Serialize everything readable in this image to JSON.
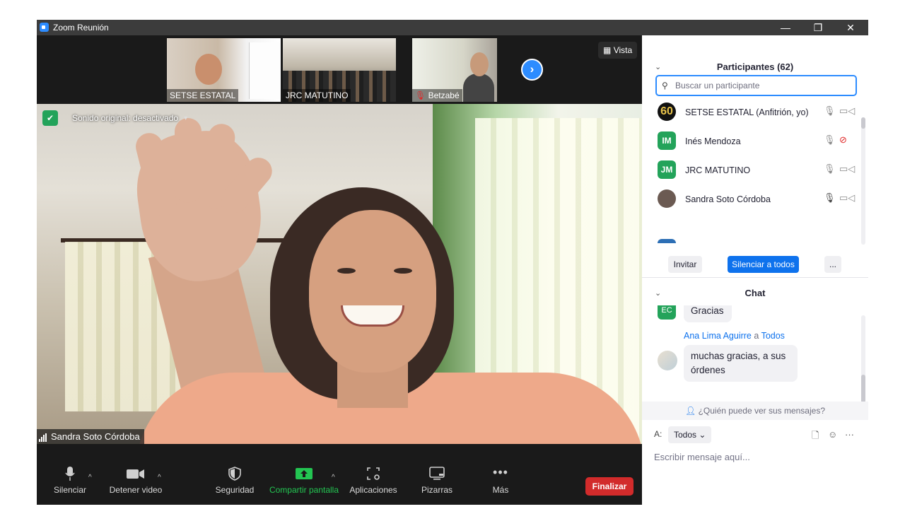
{
  "window": {
    "title": "Zoom Reunión",
    "minimize": "—",
    "restore": "❐",
    "close": "✕"
  },
  "thumbnails": [
    {
      "name": "SETSE ESTATAL",
      "muted": false
    },
    {
      "name": "JRC MATUTINO",
      "muted": false
    },
    {
      "name": "Betzabé",
      "muted": true
    }
  ],
  "view_button": "Vista",
  "next_arrow": "›",
  "sound_badge": {
    "text": "Sonido original: desactivado",
    "caret": "▾"
  },
  "active_speaker": "Sandra Soto Córdoba",
  "toolbar": {
    "mute": "Silenciar",
    "stop_video": "Detener video",
    "security": "Seguridad",
    "share": "Compartir pantalla",
    "apps": "Aplicaciones",
    "whiteboards": "Pizarras",
    "more": "Más",
    "end": "Finalizar",
    "caret": "^"
  },
  "participants_panel": {
    "title": "Participantes (62)",
    "search_placeholder": "Buscar un participante",
    "rows": [
      {
        "initials": "60",
        "name": "SETSE ESTATAL (Anfitrión, yo)",
        "color": "#111111",
        "video_off": false
      },
      {
        "initials": "IM",
        "name": "Inés Mendoza",
        "color": "#23a35a",
        "video_off": true
      },
      {
        "initials": "JM",
        "name": "JRC MATUTINO",
        "color": "#23a35a",
        "video_off": false
      },
      {
        "initials": "",
        "name": "Sandra Soto Córdoba",
        "color": "#6b5a52",
        "video_off": false
      }
    ],
    "invite": "Invitar",
    "mute_all": "Silenciar a todos",
    "more": "..."
  },
  "chat_panel": {
    "title": "Chat",
    "messages": [
      {
        "avatar": "EC",
        "text": "Gracias"
      },
      {
        "sender": "Ana Lima Aguirre",
        "connector": "a",
        "recipient": "Todos",
        "text": "muchas gracias, a sus órdenes"
      }
    ],
    "who_can_see": "¿Quién puede ver sus mensajes?",
    "to_label": "A:",
    "to_value": "Todos",
    "input_placeholder": "Escribir mensaje aquí...",
    "more": "···"
  },
  "colors": {
    "zoom_blue": "#2d8cff",
    "end_red": "#d22b2b",
    "share_green": "#23c552",
    "security_green": "#23a35a"
  }
}
